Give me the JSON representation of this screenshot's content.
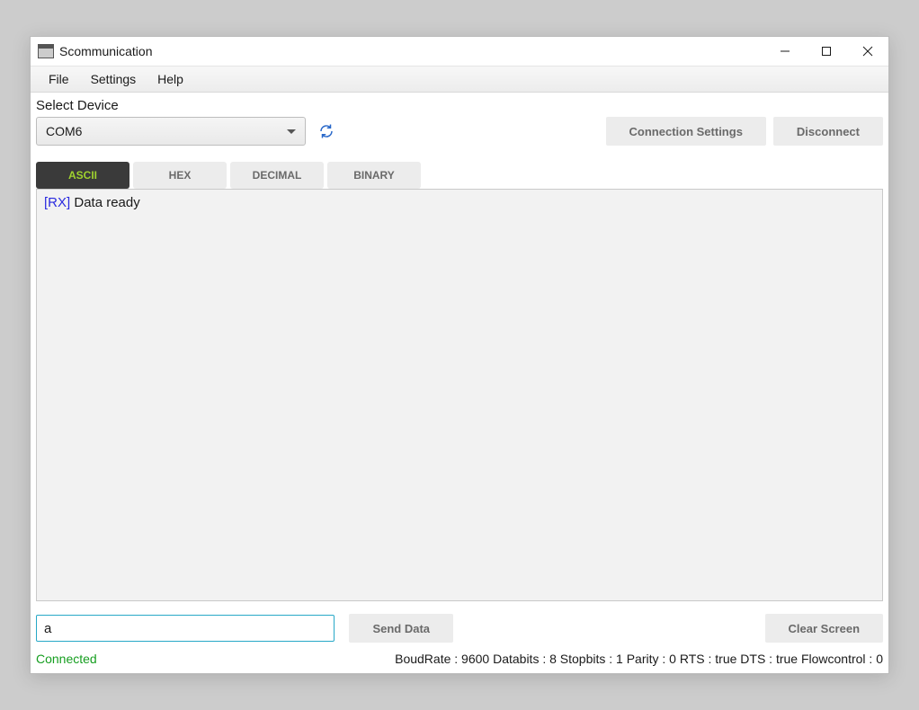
{
  "window": {
    "title": "Scommunication"
  },
  "menu": {
    "items": [
      "File",
      "Settings",
      "Help"
    ]
  },
  "device": {
    "label": "Select Device",
    "selected": "COM6"
  },
  "buttons": {
    "connection_settings": "Connection Settings",
    "disconnect": "Disconnect",
    "send_data": "Send Data",
    "clear_screen": "Clear Screen"
  },
  "tabs": {
    "items": [
      "ASCII",
      "HEX",
      "DECIMAL",
      "BINARY"
    ],
    "active": 0
  },
  "terminal": {
    "rx_prefix": "[RX]",
    "line": "Data ready"
  },
  "input": {
    "value": "a"
  },
  "status": {
    "connection": "Connected",
    "details": "BoudRate : 9600 Databits : 8 Stopbits : 1 Parity : 0 RTS : true DTS : true Flowcontrol : 0"
  }
}
